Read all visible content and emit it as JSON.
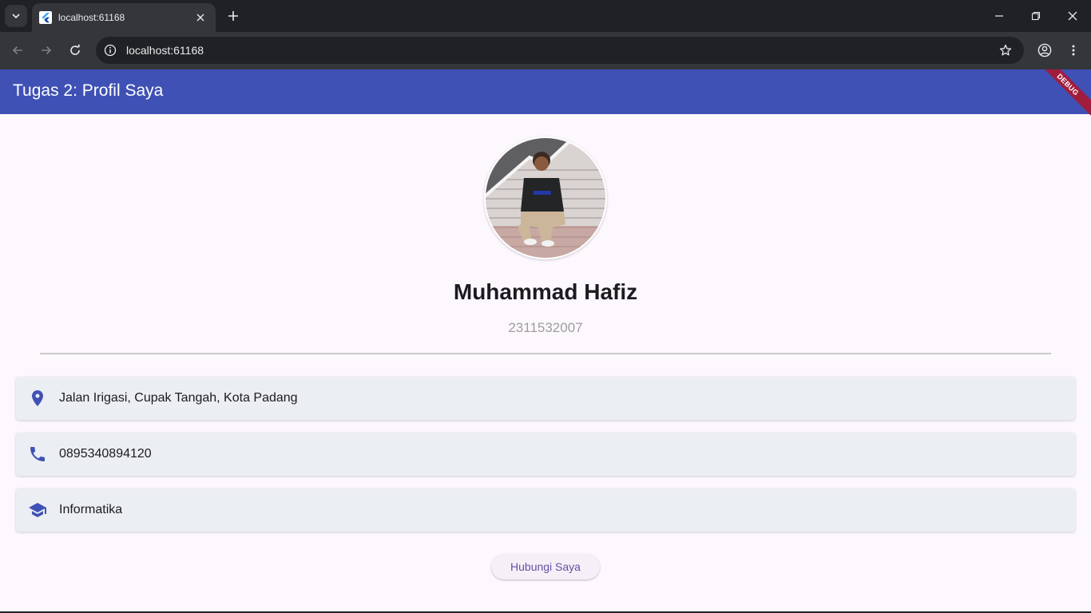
{
  "browser": {
    "tab_title": "localhost:61168",
    "url": "localhost:61168"
  },
  "app": {
    "title": "Tugas 2: Profil Saya",
    "debug_label": "DEBUG"
  },
  "profile": {
    "name": "Muhammad Hafiz",
    "nim": "2311532007"
  },
  "info_cards": [
    {
      "icon": "location-pin-icon",
      "text": "Jalan Irigasi, Cupak Tangah, Kota Padang"
    },
    {
      "icon": "phone-icon",
      "text": "0895340894120"
    },
    {
      "icon": "school-icon",
      "text": "Informatika"
    }
  ],
  "contact_button": {
    "label": "Hubungi Saya"
  },
  "colors": {
    "appbar": "#3f51b5",
    "accent": "#3f51b5",
    "background": "#fdf7fe",
    "card": "#ebeef2",
    "button_text": "#6750a4"
  }
}
